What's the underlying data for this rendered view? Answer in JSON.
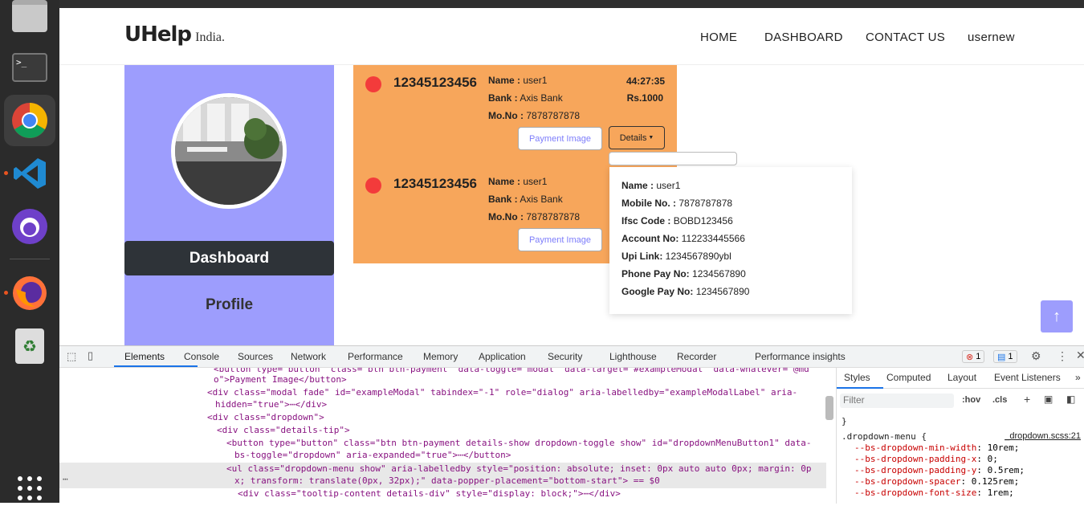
{
  "dock": {
    "items": [
      {
        "name": "files-icon"
      },
      {
        "name": "terminal-icon",
        "glyph": ">_"
      },
      {
        "name": "chrome-icon"
      },
      {
        "name": "vscode-icon"
      },
      {
        "name": "github-desktop-icon"
      },
      {
        "name": "firefox-icon"
      },
      {
        "name": "trash-icon"
      },
      {
        "name": "app-grid-icon"
      }
    ],
    "accent_color": "#e95420"
  },
  "navbar": {
    "logo_main": "UHelp",
    "logo_sub": "India.",
    "links": [
      "HOME",
      "DASHBOARD",
      "CONTACT US",
      "usernew"
    ]
  },
  "sidebar": {
    "dashboard_label": "Dashboard",
    "profile_label": "Profile",
    "color": "#9d9dfd"
  },
  "cards": [
    {
      "account": "12345123456",
      "name_label": "Name :",
      "name": "user1",
      "bank_label": "Bank :",
      "bank": "Axis Bank",
      "mobile_label": "Mo.No :",
      "mobile": "7878787878",
      "time": "44:27:35",
      "amount": "Rs.1000",
      "payment_button": "Payment Image",
      "details_button": "Details"
    },
    {
      "account": "12345123456",
      "name_label": "Name :",
      "name": "user1",
      "bank_label": "Bank :",
      "bank": "Axis Bank",
      "mobile_label": "Mo.No :",
      "mobile": "7878787878",
      "payment_button": "Payment Image"
    }
  ],
  "details_popup": {
    "rows": [
      {
        "label": "Name :",
        "value": "user1"
      },
      {
        "label": "Mobile No. :",
        "value": "7878787878"
      },
      {
        "label": "Ifsc Code :",
        "value": "BOBD123456"
      },
      {
        "label": "Account No:",
        "value": "112233445566"
      },
      {
        "label": "Upi Link:",
        "value": "1234567890ybl"
      },
      {
        "label": "Phone Pay No:",
        "value": "1234567890"
      },
      {
        "label": "Google Pay No:",
        "value": "1234567890"
      }
    ]
  },
  "devtools": {
    "tabs": [
      "Elements",
      "Console",
      "Sources",
      "Network",
      "Performance",
      "Memory",
      "Application",
      "Security",
      "Lighthouse",
      "Recorder",
      "Performance insights"
    ],
    "error_count": "1",
    "message_count": "1",
    "code_lines": [
      "<button type=\"button\" class=\"btn btn-payment\" data-toggle=\"modal\" data-target=\"#exampleModal\" data-whatever=\"@md",
      "o\">Payment Image</button>",
      "<div class=\"modal fade\" id=\"exampleModal\" tabindex=\"-1\" role=\"dialog\" aria-labelledby=\"exampleModalLabel\" aria-",
      "hidden=\"true\">⋯</div>",
      "<div class=\"dropdown\">",
      "<div class=\"details-tip\">",
      "<button type=\"button\" class=\"btn btn-payment details-show dropdown-toggle show\" id=\"dropdownMenuButton1\" data-",
      "bs-toggle=\"dropdown\" aria-expanded=\"true\">⋯</button>",
      "<ul class=\"dropdown-menu show\" aria-labelledby style=\"position: absolute; inset: 0px auto auto 0px; margin: 0p",
      "x; transform: translate(0px, 32px);\" data-popper-placement=\"bottom-start\"> == $0",
      "<div class=\"tooltip-content details-div\" style=\"display: block;\">⋯</div>"
    ],
    "styles_tabs": [
      "Styles",
      "Computed",
      "Layout",
      "Event Listeners"
    ],
    "filter_placeholder": "Filter",
    "hov": ":hov",
    "cls": ".cls",
    "rule_selector": ".dropdown-menu {",
    "rule_source": "_dropdown.scss:21",
    "properties": [
      {
        "name": "--bs-dropdown-min-width",
        "value": "10rem;"
      },
      {
        "name": "--bs-dropdown-padding-x",
        "value": "0;"
      },
      {
        "name": "--bs-dropdown-padding-y",
        "value": "0.5rem;"
      },
      {
        "name": "--bs-dropdown-spacer",
        "value": "0.125rem;"
      },
      {
        "name": "--bs-dropdown-font-size",
        "value": "1rem;"
      }
    ]
  }
}
